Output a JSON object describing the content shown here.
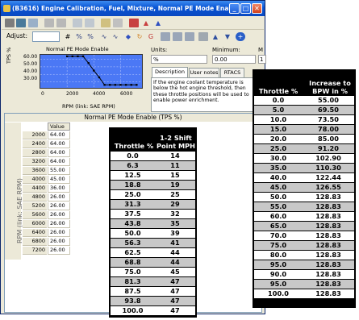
{
  "window": {
    "title": "(B3616) Engine Calibration, Fuel, Mixture, Normal PE Mode Enable",
    "minimize_glyph": "_",
    "maximize_glyph": "□",
    "close_glyph": "✕"
  },
  "toolbar": {
    "adjust_label": "Adjust:"
  },
  "mini_chart": {
    "title": "Normal PE Mode Enable",
    "ylabel": "TPS %",
    "xlabel": "RPM (link: SAE RPM)",
    "yticks": [
      "60.00",
      "50.00",
      "40.00",
      "30.00"
    ],
    "xticks": [
      "0",
      "2000",
      "4000",
      "6000"
    ]
  },
  "chart_data": {
    "type": "line",
    "title": "Normal PE Mode Enable",
    "xlabel": "RPM (link: SAE RPM)",
    "ylabel": "TPS %",
    "x": [
      2000,
      2400,
      2800,
      3200,
      3600,
      4000,
      4400,
      4800,
      5200,
      5600,
      6000,
      6400,
      6800,
      7200
    ],
    "values": [
      64.0,
      64.0,
      64.0,
      64.0,
      55.0,
      45.0,
      36.0,
      26.0,
      26.0,
      26.0,
      26.0,
      26.0,
      26.0,
      26.0
    ],
    "xlim": [
      0,
      7600
    ],
    "ylim": [
      22,
      66
    ],
    "grid": true
  },
  "panel": {
    "units_label": "Units:",
    "minimum_label": "Minimum:",
    "m_label": "M",
    "units_value": "%",
    "minimum_value": "0.00",
    "m_value": "1",
    "tabs": [
      "Description",
      "User notes",
      "RTACS"
    ],
    "description": "If the engine coolant temperature is below the hot engine threshold, then these throttle positions will be used to enable power enrichment."
  },
  "table": {
    "title": "Normal PE Mode Enable (TPS %)",
    "row_axis_label": "RPM (link: SAE RPM)",
    "value_header": "Value",
    "rows": [
      {
        "rpm": "2000",
        "value": "64.00"
      },
      {
        "rpm": "2400",
        "value": "64.00"
      },
      {
        "rpm": "2800",
        "value": "64.00"
      },
      {
        "rpm": "3200",
        "value": "64.00"
      },
      {
        "rpm": "3600",
        "value": "55.00"
      },
      {
        "rpm": "4000",
        "value": "45.00"
      },
      {
        "rpm": "4400",
        "value": "36.00"
      },
      {
        "rpm": "4800",
        "value": "26.00"
      },
      {
        "rpm": "5200",
        "value": "26.00"
      },
      {
        "rpm": "5600",
        "value": "26.00"
      },
      {
        "rpm": "6000",
        "value": "26.00"
      },
      {
        "rpm": "6400",
        "value": "26.00"
      },
      {
        "rpm": "6800",
        "value": "26.00"
      },
      {
        "rpm": "7200",
        "value": "26.00"
      }
    ]
  },
  "shift_table": {
    "col1_header": "Throttle %",
    "col2_header_line1": "1-2 Shift",
    "col2_header_line2": "Point MPH",
    "rows": [
      [
        "0.0",
        "14"
      ],
      [
        "6.3",
        "11"
      ],
      [
        "12.5",
        "15"
      ],
      [
        "18.8",
        "19"
      ],
      [
        "25.0",
        "25"
      ],
      [
        "31.3",
        "29"
      ],
      [
        "37.5",
        "32"
      ],
      [
        "43.8",
        "35"
      ],
      [
        "50.0",
        "39"
      ],
      [
        "56.3",
        "41"
      ],
      [
        "62.5",
        "44"
      ],
      [
        "68.8",
        "44"
      ],
      [
        "75.0",
        "45"
      ],
      [
        "81.3",
        "47"
      ],
      [
        "87.5",
        "47"
      ],
      [
        "93.8",
        "47"
      ],
      [
        "100.0",
        "47"
      ]
    ]
  },
  "bpw_table": {
    "col1_header": "Throttle %",
    "col2_header_line1": "Increase to",
    "col2_header_line2": "BPW in %",
    "rows": [
      [
        "0.0",
        "55.00"
      ],
      [
        "5.0",
        "69.50"
      ],
      [
        "10.0",
        "73.50"
      ],
      [
        "15.0",
        "78.00"
      ],
      [
        "20.0",
        "85.00"
      ],
      [
        "25.0",
        "91.20"
      ],
      [
        "30.0",
        "102.90"
      ],
      [
        "35.0",
        "110.30"
      ],
      [
        "40.0",
        "122.44"
      ],
      [
        "45.0",
        "126.55"
      ],
      [
        "50.0",
        "128.83"
      ],
      [
        "55.0",
        "128.83"
      ],
      [
        "60.0",
        "128.83"
      ],
      [
        "65.0",
        "128.83"
      ],
      [
        "70.0",
        "128.83"
      ],
      [
        "75.0",
        "128.83"
      ],
      [
        "80.0",
        "128.83"
      ],
      [
        "95.0",
        "128.83"
      ],
      [
        "90.0",
        "128.83"
      ],
      [
        "95.0",
        "128.83"
      ],
      [
        "100.0",
        "128.83"
      ]
    ]
  }
}
